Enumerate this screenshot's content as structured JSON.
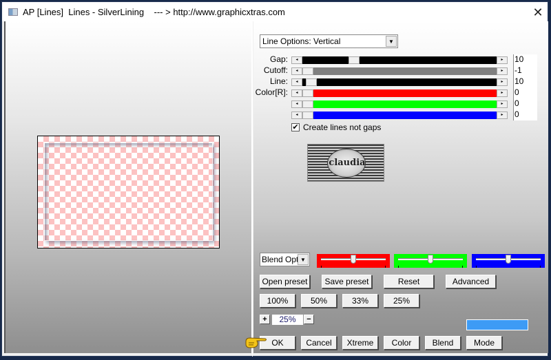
{
  "window": {
    "title": "AP [Lines]  Lines - SilverLining    --- > http://www.graphicxtras.com",
    "close_glyph": "✕"
  },
  "options": {
    "line_options": "Line Options: Vertical",
    "dropdown_arrow": "▼"
  },
  "sliders": [
    {
      "label": "Gap:",
      "value": "10",
      "color": "#000000",
      "fill_fraction": 0.25
    },
    {
      "label": "Cutoff:",
      "value": "-1",
      "color": "#808080",
      "fill_fraction": 0.0
    },
    {
      "label": "Line:",
      "value": "10",
      "color": "#000000",
      "fill_fraction": 0.02
    },
    {
      "label": "Color[R]:",
      "value": "0",
      "color": "#ff0000",
      "fill_fraction": 0.0
    },
    {
      "label": "",
      "value": "0",
      "color": "#00ff00",
      "fill_fraction": 0.0
    },
    {
      "label": "",
      "value": "0",
      "color": "#0000ff",
      "fill_fraction": 0.0
    }
  ],
  "scroll_arrows": {
    "left": "◂",
    "right": "▸"
  },
  "checkbox": {
    "label": "Create lines not gaps",
    "checked": true,
    "glyph": "✔"
  },
  "logo": {
    "text": "claudia"
  },
  "blend": {
    "select_value": "Blend Options",
    "color_sliders": [
      {
        "name": "red",
        "color": "#ff0000",
        "value_fraction": 0.5
      },
      {
        "name": "green",
        "color": "#00ff00",
        "value_fraction": 0.5
      },
      {
        "name": "blue",
        "color": "#0000ff",
        "value_fraction": 0.5
      }
    ]
  },
  "preset_buttons": [
    "Open preset",
    "Save preset",
    "Reset",
    "Advanced"
  ],
  "zoom_buttons": [
    "100%",
    "50%",
    "33%",
    "25%"
  ],
  "zoom": {
    "plus": "+",
    "minus": "−",
    "value": "25%"
  },
  "swatch_color": "#3d9bf5",
  "bottom_buttons": [
    "OK",
    "Cancel",
    "Xtreme",
    "Color",
    "Blend",
    "Mode"
  ]
}
